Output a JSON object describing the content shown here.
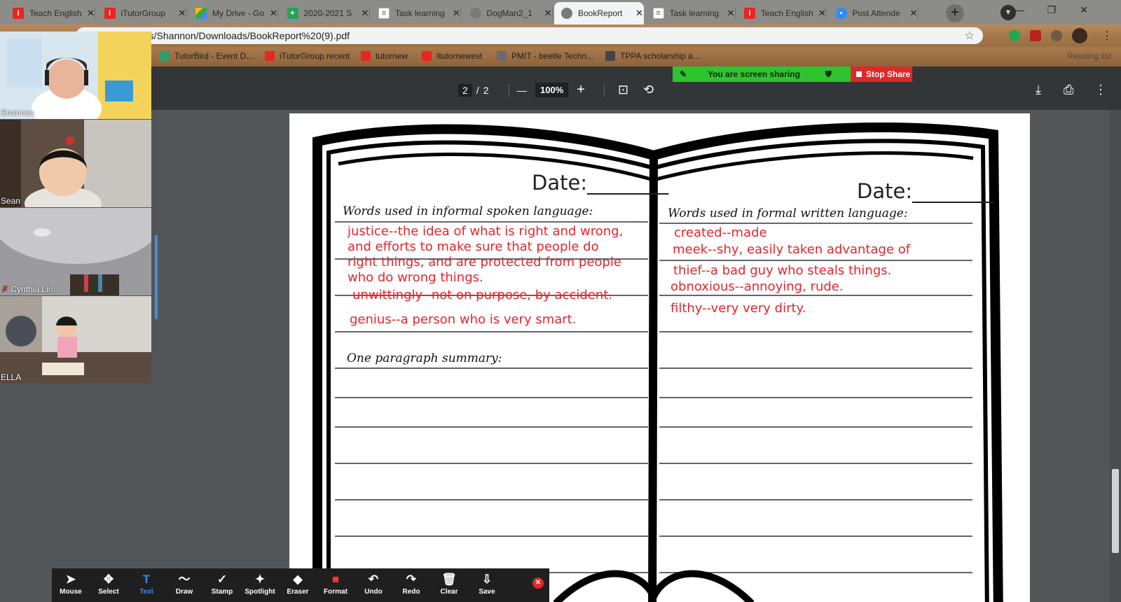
{
  "browser": {
    "tabs": [
      {
        "label": "Teach English",
        "icon": "itutor-icon",
        "fav": "fav-red",
        "glyph": "i"
      },
      {
        "label": "iTutorGroup",
        "icon": "itutor-icon",
        "fav": "fav-red",
        "glyph": "i"
      },
      {
        "label": "My Drive - Go",
        "icon": "google-drive-icon",
        "fav": "fav-drive",
        "glyph": ""
      },
      {
        "label": "2020-2021 S",
        "icon": "google-sheets-icon",
        "fav": "fav-green",
        "glyph": "+"
      },
      {
        "label": "Task learning",
        "icon": "document-icon",
        "fav": "fav-doc",
        "glyph": "≡"
      },
      {
        "label": "DogMan2_1",
        "icon": "globe-icon",
        "fav": "fav-globe",
        "glyph": ""
      },
      {
        "label": "BookReport",
        "icon": "globe-icon",
        "fav": "fav-globe",
        "glyph": "",
        "active": true
      },
      {
        "label": "Task learning",
        "icon": "document-icon",
        "fav": "fav-doc",
        "glyph": "≡"
      },
      {
        "label": "Teach English",
        "icon": "itutor-icon",
        "fav": "fav-red",
        "glyph": "i"
      },
      {
        "label": "Post Attende",
        "icon": "zoom-icon",
        "fav": "fav-zoom",
        "glyph": "▪"
      }
    ],
    "url": "rs/Shannon/Downloads/BookReport%20(9).pdf",
    "bookmarks": [
      {
        "label": "TutorBird - Event D...",
        "color": "#2f9e6a"
      },
      {
        "label": "iTutorGroup recent",
        "color": "#e8261f"
      },
      {
        "label": "tutornew",
        "color": "#e8261f"
      },
      {
        "label": "Itutornewest",
        "color": "#e8261f"
      },
      {
        "label": "PMIT - beetle Techn...",
        "color": "#6b6b6b"
      },
      {
        "label": "TPPA scholarship a...",
        "color": "#444"
      }
    ],
    "reading_list": "Reading list"
  },
  "share_banner": {
    "status": "You are screen sharing",
    "stop_label": "Stop Share"
  },
  "pdf": {
    "page_current": "2",
    "page_total": "2",
    "zoom": "100%"
  },
  "worksheet": {
    "left_date": "Date:________",
    "right_date": "Date:________",
    "left_header": "Words used in informal spoken language:",
    "right_header": "Words used in formal written language:",
    "summary_header": "One paragraph summary:",
    "left_notes": [
      "justice--the idea of what is right and wrong,",
      "and efforts to make sure that people do",
      "right things, and are protected from people",
      "who do wrong things."
    ],
    "left_note_2": "unwittingly--not on purpose, by accident.",
    "left_note_3": "genius--a person who is very smart.",
    "right_notes": [
      "created--made",
      "meek--shy, easily taken advantage of"
    ],
    "right_notes_2": [
      "thief--a bad guy who steals things.",
      "obnoxious--annoying, rude."
    ],
    "right_note_3": "filthy--very very dirty."
  },
  "participants": [
    {
      "name": "Shannon",
      "bg": "#cfe2ee"
    },
    {
      "name": "Sean",
      "bg": "#5a4a40"
    },
    {
      "name": "Cynthia Lin",
      "bg": "#8f8f95"
    },
    {
      "name": "ELLA",
      "bg": "#7b6c60"
    }
  ],
  "annotation_tools": [
    {
      "label": "Mouse",
      "icon": "mouse-pointer-icon",
      "glyph": "➤"
    },
    {
      "label": "Select",
      "icon": "select-move-icon",
      "glyph": "✥"
    },
    {
      "label": "Text",
      "icon": "text-icon",
      "glyph": "T",
      "selected": true
    },
    {
      "label": "Draw",
      "icon": "draw-squiggle-icon",
      "glyph": "〜"
    },
    {
      "label": "Stamp",
      "icon": "stamp-check-icon",
      "glyph": "✓"
    },
    {
      "label": "Spotlight",
      "icon": "spotlight-wand-icon",
      "glyph": "✦"
    },
    {
      "label": "Eraser",
      "icon": "eraser-icon",
      "glyph": "◆"
    },
    {
      "label": "Format",
      "icon": "format-color-icon",
      "glyph": "■"
    },
    {
      "label": "Undo",
      "icon": "undo-icon",
      "glyph": "↶"
    },
    {
      "label": "Redo",
      "icon": "redo-icon",
      "glyph": "↷"
    },
    {
      "label": "Clear",
      "icon": "trash-icon",
      "glyph": "🗑"
    },
    {
      "label": "Save",
      "icon": "save-download-icon",
      "glyph": "⇩"
    }
  ],
  "colors": {
    "annotation_red": "#e3262d",
    "share_green": "#2dc42d",
    "stop_red": "#e02828",
    "zoom_blue": "#2d8cff"
  }
}
